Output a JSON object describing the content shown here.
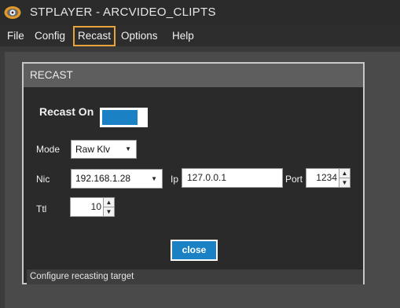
{
  "app": {
    "title": "STPLAYER - ARCVIDEO_CLIPTS"
  },
  "menu": {
    "items": [
      {
        "label": "File"
      },
      {
        "label": "Config"
      },
      {
        "label": "Recast"
      },
      {
        "label": "Options"
      },
      {
        "label": "Help"
      }
    ],
    "active": "Recast"
  },
  "dialog": {
    "title": "RECAST",
    "recast_on_label": "Recast On",
    "recast_on": true,
    "mode_label": "Mode",
    "mode_value": "Raw Klv",
    "nic_label": "Nic",
    "nic_value": "192.168.1.28",
    "ip_label": "Ip",
    "ip_value": "127.0.0.1",
    "port_label": "Port",
    "port_value": "1234",
    "ttl_label": "Ttl",
    "ttl_value": "10",
    "close_label": "close",
    "status_text": "Configure recasting target"
  },
  "colors": {
    "accent": "#1a82c4",
    "menu_highlight": "#e8a33a",
    "dialog_bg": "#2a2a2a",
    "header_bg": "#5e5e5e"
  },
  "icons": {
    "app": "eye-logo-icon",
    "dropdown": "chevron-down-icon",
    "spin_up": "arrow-up-icon",
    "spin_down": "arrow-down-icon"
  }
}
